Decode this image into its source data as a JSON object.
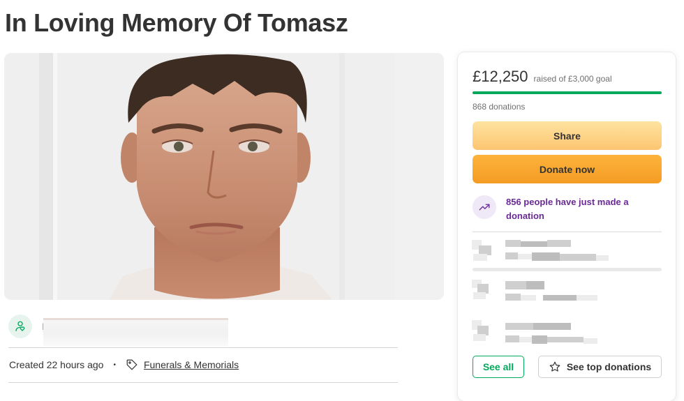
{
  "page": {
    "title": "In Loving Memory Of Tomasz"
  },
  "organizer": {
    "name_initial": "F",
    "icon": "user-heart-icon"
  },
  "meta": {
    "created": "Created 22 hours ago",
    "separator": "•",
    "category": "Funerals & Memorials",
    "category_icon": "tag-icon"
  },
  "donation_card": {
    "amount": "£12,250",
    "goal_text": "raised of £3,000 goal",
    "progress_fraction": 1.0,
    "donations_count": "868 donations",
    "share_label": "Share",
    "donate_label": "Donate now",
    "trend_text": "856 people have just made a donation",
    "trend_icon": "trending-up-icon",
    "see_all_label": "See all",
    "see_top_label": "See top donations",
    "see_top_icon": "star-icon"
  },
  "colors": {
    "accent_green": "#02a95c",
    "share_button": "#fdd58a",
    "donate_button": "#f8a630",
    "trend_purple": "#6a2a96"
  }
}
